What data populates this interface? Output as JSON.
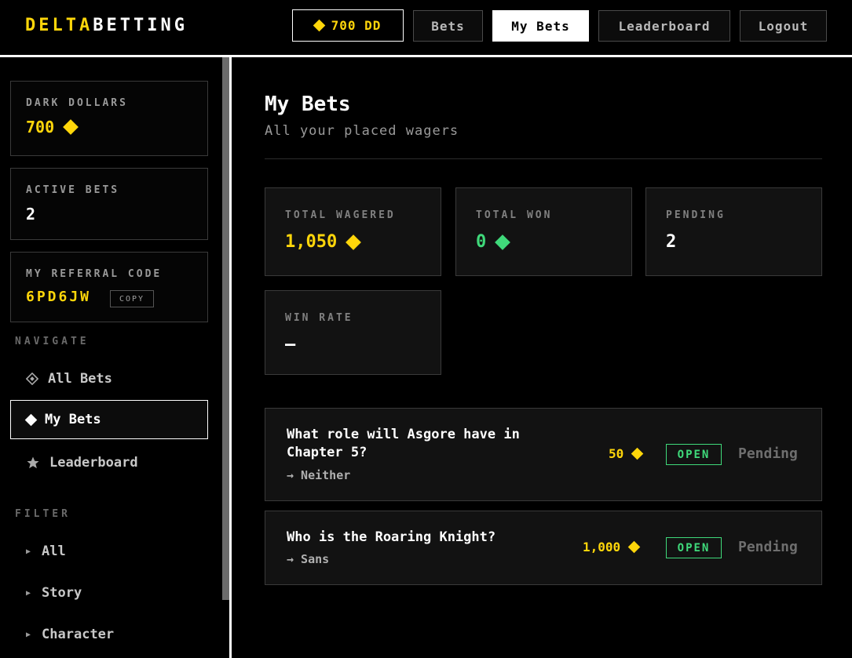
{
  "header": {
    "logo_part1": "DELTA",
    "logo_part2": "BETTING",
    "balance": "700 DD",
    "nav": [
      "Bets",
      "My Bets",
      "Leaderboard",
      "Logout"
    ]
  },
  "sidebar": {
    "dark_dollars": {
      "label": "DARK DOLLARS",
      "value": "700"
    },
    "active_bets": {
      "label": "ACTIVE BETS",
      "value": "2"
    },
    "referral": {
      "label": "MY REFERRAL CODE",
      "code": "6PD6JW",
      "copy_label": "COPY"
    },
    "navigate_head": "NAVIGATE",
    "nav": [
      {
        "label": "All Bets",
        "icon": "diamond-outline-icon"
      },
      {
        "label": "My Bets",
        "icon": "diamond-icon"
      },
      {
        "label": "Leaderboard",
        "icon": "star-icon"
      }
    ],
    "filter_head": "FILTER",
    "filters": [
      "All",
      "Story",
      "Character"
    ]
  },
  "main": {
    "title": "My Bets",
    "subtitle": "All your placed wagers",
    "stats": [
      {
        "label": "TOTAL WAGERED",
        "value": "1,050"
      },
      {
        "label": "TOTAL WON",
        "value": "0"
      },
      {
        "label": "PENDING",
        "value": "2"
      },
      {
        "label": "WIN RATE",
        "value": "—"
      }
    ],
    "bets": [
      {
        "question": "What role will Asgore have in Chapter 5?",
        "pick": "→ Neither",
        "amount": "50",
        "status": "OPEN",
        "result": "Pending"
      },
      {
        "question": "Who is the Roaring Knight?",
        "pick": "→ Sans",
        "amount": "1,000",
        "status": "OPEN",
        "result": "Pending"
      }
    ]
  },
  "colors": {
    "accent": "#ffd60a",
    "positive": "#3fd97a",
    "background": "#000000",
    "card": "#121212"
  }
}
